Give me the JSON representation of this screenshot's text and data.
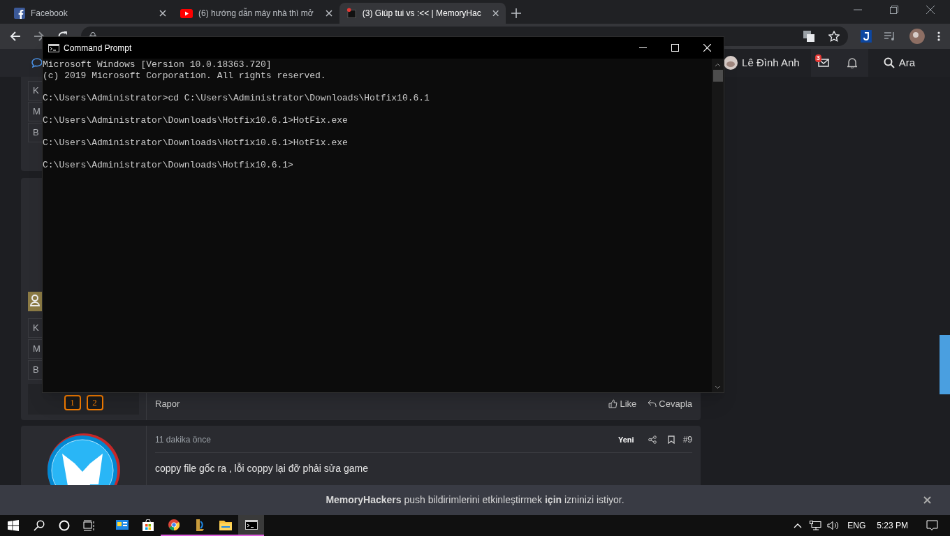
{
  "browser": {
    "tabs": [
      {
        "title": "Facebook",
        "kind": "facebook",
        "selected": false
      },
      {
        "title": "(6) hướng dẫn máy nhà thì mở",
        "kind": "youtube",
        "selected": false
      },
      {
        "title": "(3) Giúp tui vs :<< | MemoryHac",
        "kind": "site",
        "selected": true
      }
    ]
  },
  "site_nav": {
    "user": "Lê Đình Anh",
    "mail_badge": "3",
    "search": "Ara"
  },
  "posts": [
    {
      "user_fields": [
        "K",
        "M",
        "B"
      ]
    },
    {
      "user_fields": [
        "K",
        "M",
        "B"
      ],
      "badges": [
        "1",
        "2"
      ],
      "report": "Rapor",
      "like": "Like",
      "reply": "Cevapla"
    },
    {
      "time": "11 dakika önce",
      "new_label": "Yeni",
      "number": "#9",
      "body": "coppy file gốc ra , lỗi coppy lại đỡ phải sửa game"
    }
  ],
  "cmd": {
    "title": "Command Prompt",
    "blocks": [
      [
        "Microsoft Windows [Version 10.0.18363.720]",
        "(c) 2019 Microsoft Corporation. All rights reserved."
      ],
      [
        "C:\\Users\\Administrator>cd C:\\Users\\Administrator\\Downloads\\Hotfix10.6.1"
      ],
      [
        "C:\\Users\\Administrator\\Downloads\\Hotfix10.6.1>HotFix.exe"
      ],
      [
        "C:\\Users\\Administrator\\Downloads\\Hotfix10.6.1>HotFix.exe"
      ],
      [
        "C:\\Users\\Administrator\\Downloads\\Hotfix10.6.1>"
      ]
    ]
  },
  "notification": {
    "text": "**MemoryHackers** push bildirimlerini etkinleştirmek **için** izninizi istiyor."
  },
  "taskbar": {
    "apps": [
      {
        "kind": "card",
        "open": false,
        "selected": false
      },
      {
        "kind": "store",
        "open": false,
        "selected": false
      },
      {
        "kind": "chrome",
        "open": true,
        "selected": false
      },
      {
        "kind": "game",
        "open": true,
        "selected": false
      },
      {
        "kind": "folder",
        "open": true,
        "selected": false
      },
      {
        "kind": "cmd",
        "open": true,
        "selected": true
      }
    ],
    "language": "ENG",
    "time": "5:23 PM"
  }
}
